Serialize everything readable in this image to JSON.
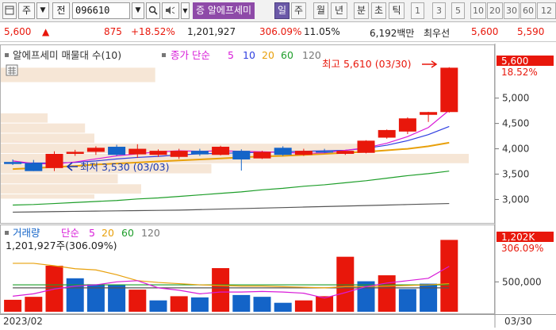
{
  "toolbar": {
    "chart_type_label": "주",
    "search_label": "전",
    "code_value": "096610",
    "name_badge": "증",
    "stock_name": "알에프세미",
    "periods": [
      "일",
      "주",
      "월",
      "년",
      "분",
      "초",
      "틱"
    ],
    "active_period": "일",
    "intervals": [
      "1",
      "3",
      "5",
      "10",
      "20",
      "30",
      "60",
      "12"
    ]
  },
  "quote": {
    "price": "5,600",
    "change_arrow": "▲",
    "change": "875",
    "change_pct": "+18.52%",
    "volume": "1,201,927",
    "volume_ratio": "306.09%",
    "turnover": "11.05%",
    "trade_value": "6,192백만",
    "priority_label": "최우선",
    "ask": "5,600",
    "bid": "5,590"
  },
  "price_panel": {
    "legend_title": "알에프세미 매물대 수(10)",
    "ma_title": "종가 단순",
    "ma_periods": [
      "5",
      "10",
      "20",
      "60",
      "120"
    ],
    "high_annotation": "최고 5,610 (03/30)",
    "low_annotation": "최저 3,530 (03/03)",
    "last_price_tag": "5,600",
    "last_change_tag": "18.52%",
    "y_ticks": [
      "5,000",
      "4,500",
      "4,000",
      "3,500",
      "3,000"
    ]
  },
  "volume_panel": {
    "title": "거래량",
    "ma_title": "단순",
    "ma_periods": [
      "5",
      "20",
      "60",
      "120"
    ],
    "volume_text": "1,201,927주(306.09%)",
    "last_volume_tag": "1,202K",
    "last_ratio_tag": "306.09%",
    "y_ticks": [
      "500,000"
    ]
  },
  "x_axis": {
    "start_label": "2023/02",
    "end_label": "03/30"
  },
  "colors": {
    "up": "#e8170b",
    "down": "#1464c8",
    "ma5": "#d81bd8",
    "ma10": "#2f3fe0",
    "ma20": "#e8a00b",
    "ma60": "#1e9e2a",
    "ma120": "#555555",
    "volume_profile": "#f6e6d6"
  },
  "chart_data": {
    "type": "candlestick",
    "price_candles": [
      {
        "open": 3740,
        "high": 3790,
        "low": 3680,
        "close": 3700
      },
      {
        "open": 3720,
        "high": 3780,
        "low": 3560,
        "close": 3560
      },
      {
        "open": 3620,
        "high": 3950,
        "low": 3560,
        "close": 3900
      },
      {
        "open": 3900,
        "high": 3980,
        "low": 3860,
        "close": 3940
      },
      {
        "open": 3940,
        "high": 4050,
        "low": 3880,
        "close": 4020
      },
      {
        "open": 4040,
        "high": 4080,
        "low": 3860,
        "close": 3880
      },
      {
        "open": 3890,
        "high": 4090,
        "low": 3820,
        "close": 4000
      },
      {
        "open": 3880,
        "high": 3990,
        "low": 3840,
        "close": 3960
      },
      {
        "open": 3840,
        "high": 4000,
        "low": 3800,
        "close": 3960
      },
      {
        "open": 3960,
        "high": 4000,
        "low": 3860,
        "close": 3890
      },
      {
        "open": 3880,
        "high": 4060,
        "low": 3870,
        "close": 4040
      },
      {
        "open": 3960,
        "high": 3990,
        "low": 3570,
        "close": 3790
      },
      {
        "open": 3810,
        "high": 3960,
        "low": 3800,
        "close": 3940
      },
      {
        "open": 4020,
        "high": 4050,
        "low": 3860,
        "close": 3880
      },
      {
        "open": 3880,
        "high": 4000,
        "low": 3860,
        "close": 3960
      },
      {
        "open": 3950,
        "high": 4000,
        "low": 3920,
        "close": 3930
      },
      {
        "open": 3900,
        "high": 3960,
        "low": 3880,
        "close": 3960
      },
      {
        "open": 3920,
        "high": 4170,
        "low": 3910,
        "close": 4160
      },
      {
        "open": 4220,
        "high": 4380,
        "low": 4200,
        "close": 4370
      },
      {
        "open": 4340,
        "high": 4620,
        "low": 4290,
        "close": 4600
      },
      {
        "open": 4670,
        "high": 4730,
        "low": 4530,
        "close": 4725
      },
      {
        "open": 4725,
        "high": 5610,
        "low": 4715,
        "close": 5600
      }
    ],
    "volumes": [
      200000,
      250000,
      770000,
      560000,
      460000,
      450000,
      370000,
      190000,
      260000,
      240000,
      730000,
      280000,
      250000,
      150000,
      190000,
      260000,
      920000,
      510000,
      610000,
      380000,
      470000,
      1201927
    ],
    "volume_up": [
      true,
      true,
      true,
      false,
      false,
      false,
      true,
      false,
      true,
      false,
      true,
      false,
      false,
      false,
      true,
      true,
      true,
      false,
      true,
      false,
      false,
      true
    ],
    "ma_price_5": [
      3760,
      3710,
      3700,
      3740,
      3800,
      3860,
      3900,
      3940,
      3960,
      3950,
      3960,
      3950,
      3940,
      3930,
      3910,
      3920,
      3970,
      4020,
      4110,
      4240,
      4420,
      4760
    ],
    "ma_price_10": [
      3720,
      3720,
      3720,
      3730,
      3760,
      3800,
      3830,
      3850,
      3880,
      3900,
      3910,
      3920,
      3930,
      3940,
      3950,
      3960,
      3970,
      4010,
      4070,
      4160,
      4280,
      4440
    ],
    "ma_price_20": [
      3600,
      3620,
      3640,
      3660,
      3690,
      3710,
      3730,
      3750,
      3770,
      3790,
      3810,
      3830,
      3850,
      3860,
      3880,
      3900,
      3920,
      3940,
      3970,
      4000,
      4050,
      4120
    ],
    "ma_price_60": [
      2890,
      2900,
      2920,
      2940,
      2960,
      2980,
      3010,
      3030,
      3060,
      3090,
      3120,
      3150,
      3190,
      3220,
      3260,
      3290,
      3330,
      3370,
      3420,
      3470,
      3510,
      3560
    ],
    "ma_price_120": [
      2750,
      2755,
      2760,
      2765,
      2770,
      2775,
      2780,
      2785,
      2790,
      2800,
      2810,
      2820,
      2830,
      2840,
      2850,
      2860,
      2870,
      2880,
      2890,
      2900,
      2910,
      2920
    ],
    "ma_volume_5": [
      260000,
      300000,
      380000,
      430000,
      450000,
      500000,
      520000,
      400000,
      360000,
      300000,
      330000,
      330000,
      340000,
      330000,
      310000,
      230000,
      320000,
      420000,
      480000,
      520000,
      560000,
      760000
    ],
    "ma_volume_20": [
      810000,
      810000,
      770000,
      720000,
      700000,
      620000,
      520000,
      490000,
      470000,
      450000,
      440000,
      430000,
      430000,
      420000,
      410000,
      400000,
      420000,
      420000,
      430000,
      440000,
      450000,
      470000
    ],
    "ma_volume_60": [
      450000,
      450000,
      450000,
      450000,
      450000,
      450000,
      450000,
      450000,
      450000,
      450000,
      450000,
      450000,
      450000,
      450000,
      450000,
      450000,
      450000,
      450000,
      450000,
      450000,
      450000,
      450000
    ],
    "ma_volume_120": [
      400000,
      400000,
      400000,
      400000,
      400000,
      400000,
      400000,
      400000,
      400000,
      400000,
      400000,
      400000,
      400000,
      400000,
      400000,
      400000,
      400000,
      400000,
      400000,
      400000,
      400000,
      400000
    ],
    "volume_profile": [
      {
        "low": 3000,
        "high": 3100,
        "value": 0.2
      },
      {
        "low": 3100,
        "high": 3300,
        "value": 0.3
      },
      {
        "low": 3300,
        "high": 3500,
        "value": 0.25
      },
      {
        "low": 3500,
        "high": 3700,
        "value": 0.45
      },
      {
        "low": 3700,
        "high": 3900,
        "value": 1.0
      },
      {
        "low": 3900,
        "high": 4100,
        "value": 0.8
      },
      {
        "low": 4100,
        "high": 4300,
        "value": 0.2
      },
      {
        "low": 4300,
        "high": 4500,
        "value": 0.18
      },
      {
        "low": 4500,
        "high": 4700,
        "value": 0.1
      },
      {
        "low": 5300,
        "high": 5600,
        "value": 0.33
      }
    ],
    "price_range": [
      2600,
      5950
    ],
    "volume_range": [
      0,
      1380000
    ]
  }
}
